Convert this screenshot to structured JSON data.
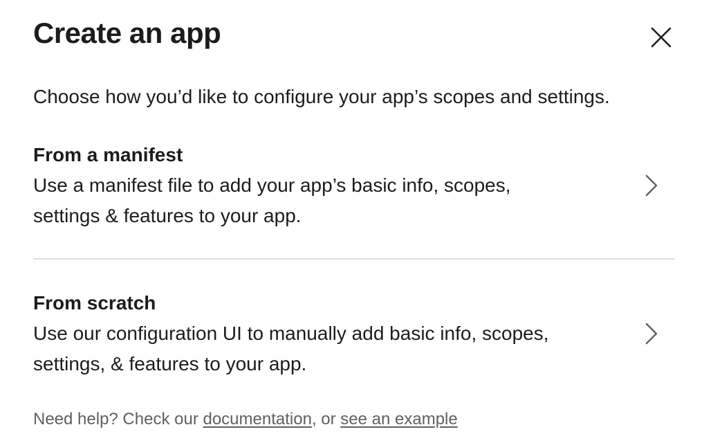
{
  "modal": {
    "title": "Create an app",
    "close_label": "Close",
    "intro": "Choose how you’d like to configure your app’s scopes and settings."
  },
  "options": [
    {
      "title": "From a manifest",
      "description": "Use a manifest file to add your app’s basic info, scopes, settings & features to your app.",
      "icon": "chevron-right-icon"
    },
    {
      "title": "From scratch",
      "description": "Use our configuration UI to manually add basic info, scopes, settings, & features to your app.",
      "icon": "chevron-right-icon"
    }
  ],
  "help": {
    "prefix": "Need help? Check our ",
    "documentation_link": "documentation",
    "separator": ", or ",
    "example_link": "see an example"
  },
  "colors": {
    "text": "#1d1c1d",
    "muted_text": "#616061",
    "divider": "#dddddd",
    "icon": "#616061"
  }
}
